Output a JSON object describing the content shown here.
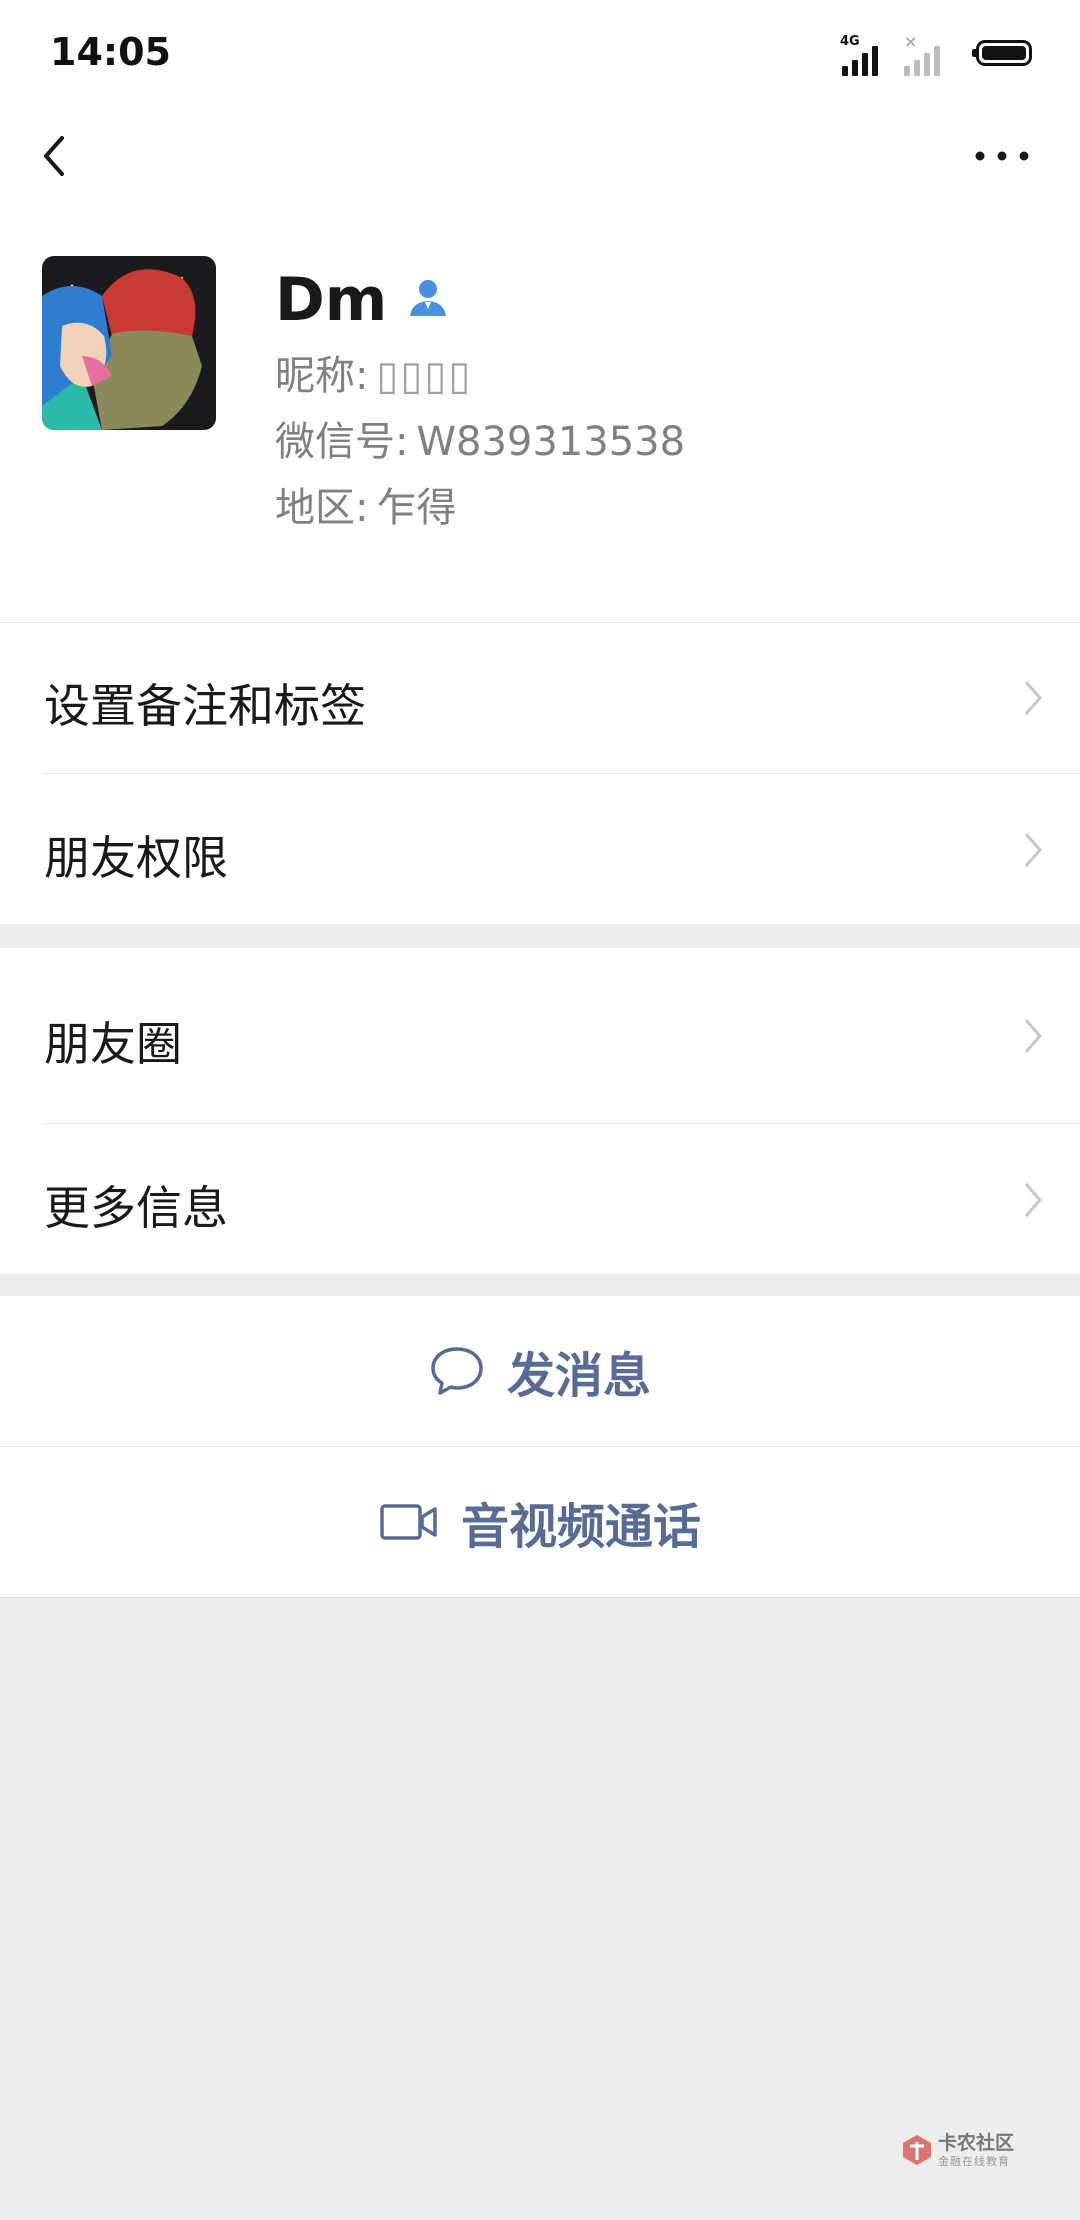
{
  "status_bar": {
    "time": "14:05",
    "network_label": "4G",
    "icons": [
      "signal-icon",
      "no-signal-icon",
      "battery-icon"
    ]
  },
  "nav": {
    "back_icon": "back-arrow-icon",
    "more_icon": "more-dots-icon"
  },
  "profile": {
    "display_name": "Dm",
    "name_icon": "contact-person-icon",
    "nickname_label": "昵称:",
    "nickname_value": "▯▯▯▯",
    "wechat_id_label": "微信号:",
    "wechat_id_value": "W839313538",
    "region_label": "地区:",
    "region_value": "乍得"
  },
  "menu_group_1": [
    {
      "label": "设置备注和标签"
    },
    {
      "label": "朋友权限"
    }
  ],
  "menu_group_2": [
    {
      "label": "朋友圈"
    },
    {
      "label": "更多信息"
    }
  ],
  "actions": {
    "message_label": "发消息",
    "message_icon": "chat-bubble-icon",
    "call_label": "音视频通话",
    "call_icon": "video-camera-icon"
  },
  "watermark": {
    "title": "卡农社区",
    "subtitle": "金融在线教育"
  },
  "colors": {
    "link_blue": "#576b95",
    "background": "#ededed",
    "verify_blue": "#4a90e2"
  }
}
